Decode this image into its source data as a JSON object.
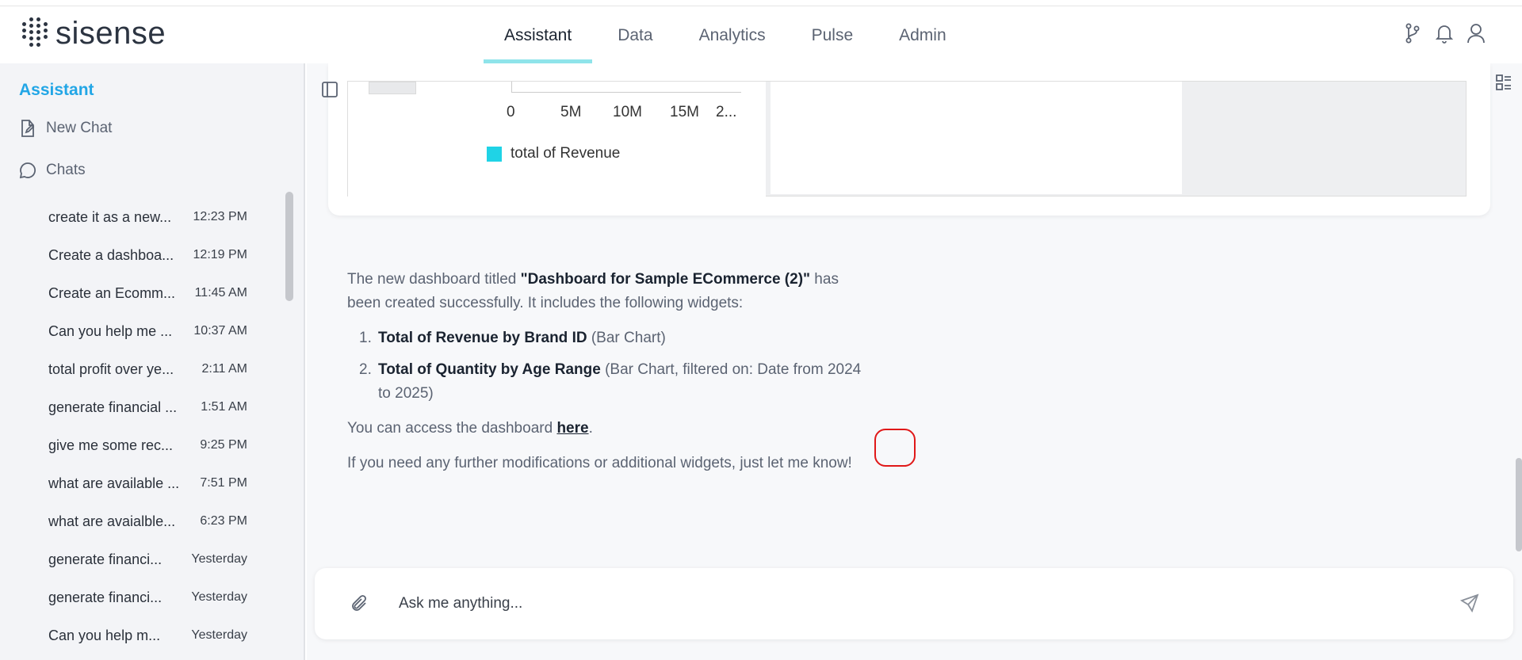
{
  "app": {
    "logo_text": "sisense"
  },
  "nav": {
    "tabs": [
      {
        "label": "Assistant",
        "active": true
      },
      {
        "label": "Data"
      },
      {
        "label": "Analytics"
      },
      {
        "label": "Pulse"
      },
      {
        "label": "Admin"
      }
    ]
  },
  "sidebar": {
    "title": "Assistant",
    "new_chat": "New Chat",
    "chats_label": "Chats",
    "chats": [
      {
        "title": "create it as a new...",
        "time": "12:23 PM"
      },
      {
        "title": "Create a dashboa...",
        "time": "12:19 PM"
      },
      {
        "title": "Create an Ecomm...",
        "time": "11:45 AM"
      },
      {
        "title": "Can you help me ...",
        "time": "10:37 AM"
      },
      {
        "title": "total profit over ye...",
        "time": "2:11 AM"
      },
      {
        "title": "generate financial ...",
        "time": "1:51 AM"
      },
      {
        "title": "give me some rec...",
        "time": "9:25 PM"
      },
      {
        "title": "what are available ...",
        "time": "7:51 PM"
      },
      {
        "title": "what are avaialble...",
        "time": "6:23 PM"
      },
      {
        "title": "generate financi...",
        "time": "Yesterday"
      },
      {
        "title": "generate financi...",
        "time": "Yesterday"
      },
      {
        "title": "Can you help m...",
        "time": "Yesterday"
      }
    ]
  },
  "chart": {
    "ticks": [
      "0",
      "5M",
      "10M",
      "15M",
      "2..."
    ],
    "legend": "total of Revenue",
    "legend_color": "#1fd3e6"
  },
  "message": {
    "intro_before": "The new dashboard titled ",
    "dashboard_title": "\"Dashboard for Sample ECommerce (2)\"",
    "intro_after": " has been created successfully. It includes the following widgets:",
    "widgets": [
      {
        "num": "1.",
        "name": "Total of Revenue by Brand ID",
        "detail": " (Bar Chart)"
      },
      {
        "num": "2.",
        "name": "Total of Quantity by Age Range",
        "detail": " (Bar Chart, filtered on: Date from 2024 to 2025)"
      }
    ],
    "access_before": "You can access the dashboard ",
    "access_link": "here",
    "access_after": ".",
    "closing": "If you need any further modifications or additional widgets, just let me know!"
  },
  "input": {
    "placeholder": "Ask me anything..."
  }
}
